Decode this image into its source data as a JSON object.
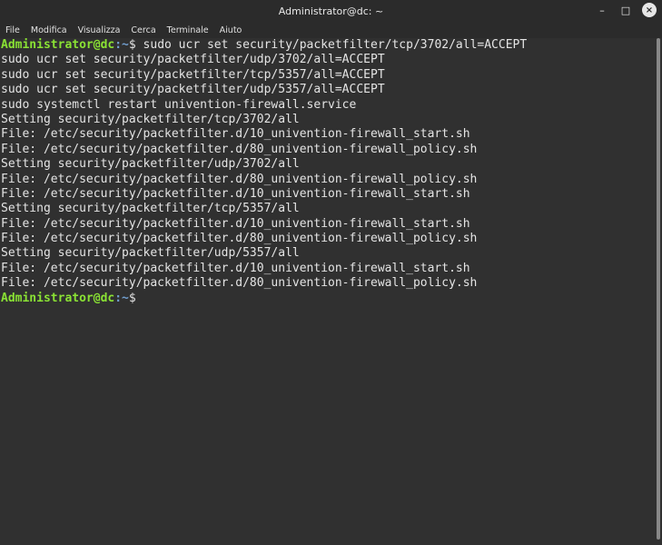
{
  "window": {
    "title": "Administrator@dc: ~",
    "controls": {
      "minimize": "–",
      "maximize": "□",
      "close": "×"
    }
  },
  "menu": [
    "File",
    "Modifica",
    "Visualizza",
    "Cerca",
    "Terminale",
    "Aiuto"
  ],
  "prompt": {
    "user_host": "Administrator@dc",
    "path": ":~",
    "symbol": "$"
  },
  "terminal": {
    "first_command": " sudo ucr set security/packetfilter/tcp/3702/all=ACCEPT",
    "lines": [
      "sudo ucr set security/packetfilter/udp/3702/all=ACCEPT",
      "sudo ucr set security/packetfilter/tcp/5357/all=ACCEPT",
      "sudo ucr set security/packetfilter/udp/5357/all=ACCEPT",
      "sudo systemctl restart univention-firewall.service",
      "Setting security/packetfilter/tcp/3702/all",
      "File: /etc/security/packetfilter.d/10_univention-firewall_start.sh",
      "File: /etc/security/packetfilter.d/80_univention-firewall_policy.sh",
      "Setting security/packetfilter/udp/3702/all",
      "File: /etc/security/packetfilter.d/80_univention-firewall_policy.sh",
      "File: /etc/security/packetfilter.d/10_univention-firewall_start.sh",
      "Setting security/packetfilter/tcp/5357/all",
      "File: /etc/security/packetfilter.d/10_univention-firewall_start.sh",
      "File: /etc/security/packetfilter.d/80_univention-firewall_policy.sh",
      "Setting security/packetfilter/udp/5357/all",
      "File: /etc/security/packetfilter.d/10_univention-firewall_start.sh",
      "File: /etc/security/packetfilter.d/80_univention-firewall_policy.sh"
    ]
  },
  "colors": {
    "prompt_user": "#8ae234",
    "prompt_path": "#729fcf",
    "background": "#303030",
    "foreground": "#e4e4e4"
  }
}
